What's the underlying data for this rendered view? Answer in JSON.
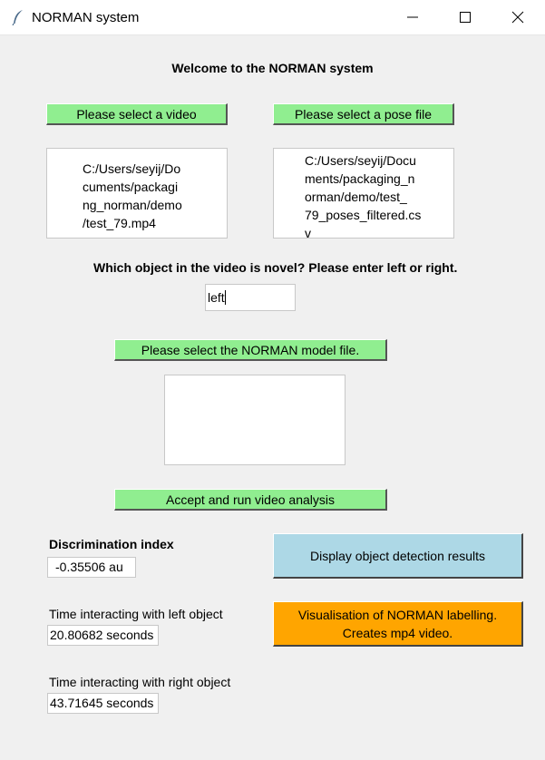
{
  "window": {
    "title": "NORMAN system"
  },
  "header": {
    "welcome": "Welcome to the NORMAN system"
  },
  "video": {
    "button_label": "Please select a video",
    "path_text": "C:/Users/seyij/Do\ncuments/packagi\nng_norman/demo\n/test_79.mp4"
  },
  "pose": {
    "button_label": "Please select a pose file",
    "path_text": "C:/Users/seyij/Docu\nments/packaging_n\norman/demo/test_\n79_poses_filtered.cs\nv"
  },
  "novel": {
    "question": "Which object in the video is novel? Please enter left or right.",
    "value": "left"
  },
  "model": {
    "button_label": "Please select the NORMAN model file.",
    "path_text": ""
  },
  "run": {
    "button_label": "Accept and run video analysis"
  },
  "results": {
    "discrimination_label": "Discrimination index",
    "discrimination_value": "-0.35506 au",
    "left_label": "Time interacting with left object",
    "left_value": "20.80682 seconds",
    "right_label": "Time interacting with right object",
    "right_value": "43.71645 seconds"
  },
  "actions": {
    "detection_label": "Display object detection results",
    "visualisation_label": "Visualisation of NORMAN labelling.\nCreates mp4 video.",
    "detection_color": "#add8e6",
    "visualisation_color": "#ffa500"
  },
  "colors": {
    "green_button": "#90ee90",
    "background": "#f0f0f0"
  },
  "icons": {
    "app": "feather-icon",
    "minimize": "minimize-icon",
    "maximize": "maximize-icon",
    "close": "close-icon"
  }
}
